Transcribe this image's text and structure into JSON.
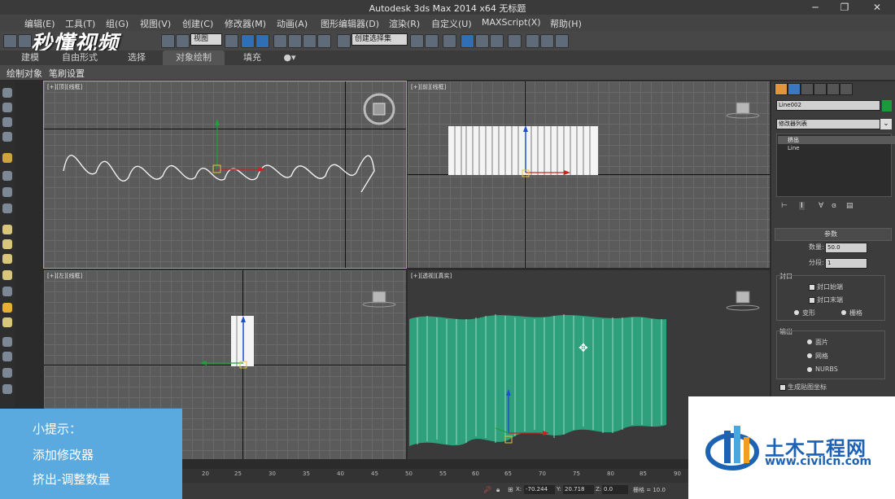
{
  "window": {
    "title": "Autodesk 3ds Max  2014 x64     无标题",
    "minimize": "─",
    "maximize": "❐",
    "close": "✕"
  },
  "menu": [
    "编辑(E)",
    "工具(T)",
    "组(G)",
    "视图(V)",
    "创建(C)",
    "修改器(M)",
    "动画(A)",
    "图形编辑器(D)",
    "渲染(R)",
    "自定义(U)",
    "MAXScript(X)",
    "帮助(H)"
  ],
  "toolbar": {
    "view_dropdown": "视图",
    "selection_set": "创建选择集"
  },
  "watermark_logo": "秒懂视频",
  "ribbon": {
    "tabs": [
      "建模",
      "自由形式",
      "选择",
      "对象绘制",
      "填充"
    ],
    "active_tab": "对象绘制",
    "sub_items": [
      "绘制对象",
      "笔刷设置"
    ]
  },
  "viewports": {
    "top": "[+][顶][线框]",
    "front": "[+][前][线框]",
    "left": "[+][左][线框]",
    "perspective": "[+][透视][真实]"
  },
  "command_panel": {
    "object_name": "Line002",
    "color": "#1a9a3a",
    "modifier_list_label": "修改器列表",
    "stack": [
      "挤出",
      "Line"
    ],
    "params_title": "参数",
    "amount_label": "数量:",
    "amount_value": "50.0",
    "segments_label": "分段:",
    "segments_value": "1",
    "capping_title": "封口",
    "cap_start": "封口始端",
    "cap_end": "封口末端",
    "morph": "变形",
    "grid": "栅格",
    "output_title": "输出",
    "patch": "面片",
    "mesh": "网格",
    "nurbs": "NURBS",
    "gen_map": "生成贴图坐标"
  },
  "tip": {
    "title": "小提示：",
    "line1": "添加修改器",
    "line2": "挤出-调整数量"
  },
  "timeline": {
    "ticks": [
      "20",
      "25",
      "30",
      "35",
      "40",
      "45",
      "50",
      "55",
      "60",
      "65",
      "70",
      "75",
      "80",
      "85",
      "90"
    ],
    "x_label": "X:",
    "x_value": "-70.244",
    "y_label": "Y:",
    "y_value": "20.718",
    "z_label": "Z:",
    "z_value": "0.0",
    "grid": "栅格 = 10.0"
  },
  "site_watermark": {
    "name": "土木工程网",
    "url": "www.civilcn.com"
  }
}
